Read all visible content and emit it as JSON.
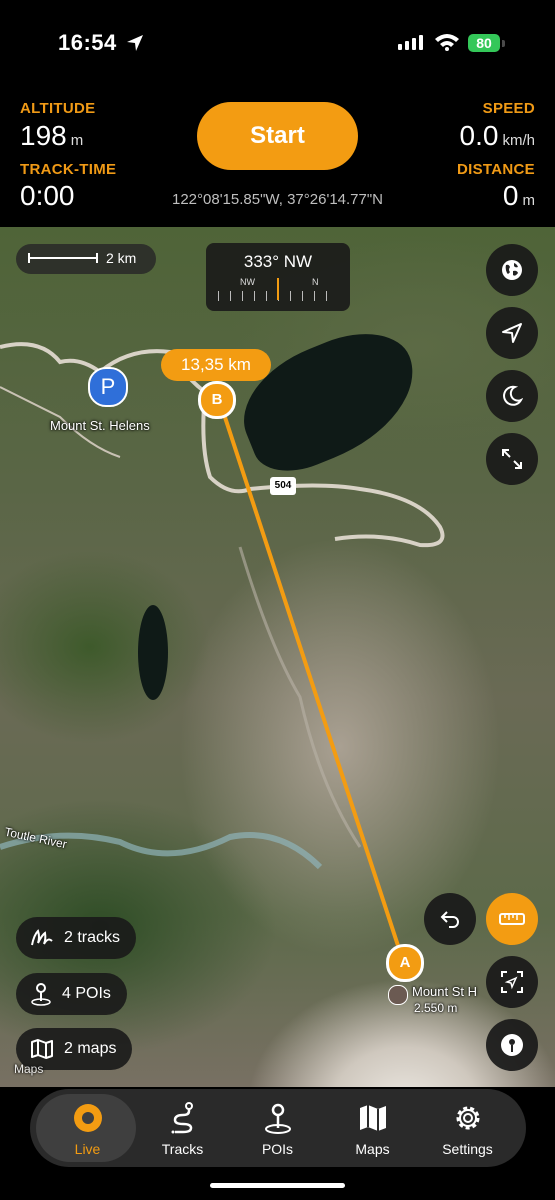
{
  "status": {
    "time": "16:54",
    "battery": "80"
  },
  "header": {
    "altitude_label": "ALTITUDE",
    "altitude_value": "198",
    "altitude_unit": "m",
    "tracktime_label": "TRACK-TIME",
    "tracktime_value": "0:00",
    "speed_label": "SPEED",
    "speed_value": "0.0",
    "speed_unit": "km/h",
    "distance_label": "DISTANCE",
    "distance_value": "0",
    "distance_unit": "m",
    "start_label": "Start",
    "coordinates": "122°08'15.85\"W, 37°26'14.77\"N"
  },
  "map": {
    "scale_label": "2 km",
    "compass_heading": "333° NW",
    "compass_left": "NW",
    "compass_right": "N",
    "distance_badge": "13,35 km",
    "marker_a": "A",
    "marker_b": "B",
    "parking_label": "P",
    "place_label": "Mount St. Helens",
    "highway_label": "504",
    "river_label": "Toutle River",
    "summit_name": "Mount St H",
    "summit_elev": "2.550 m",
    "attribution": "Maps",
    "tracks_label": "2 tracks",
    "pois_label": "4 POIs",
    "maps_label": "2 maps",
    "accent_color": "#f39c12"
  },
  "tabs": [
    {
      "label": "Live",
      "icon": "live-icon"
    },
    {
      "label": "Tracks",
      "icon": "tracks-icon"
    },
    {
      "label": "POIs",
      "icon": "poi-pin-icon"
    },
    {
      "label": "Maps",
      "icon": "map-icon"
    },
    {
      "label": "Settings",
      "icon": "gear-icon"
    }
  ]
}
